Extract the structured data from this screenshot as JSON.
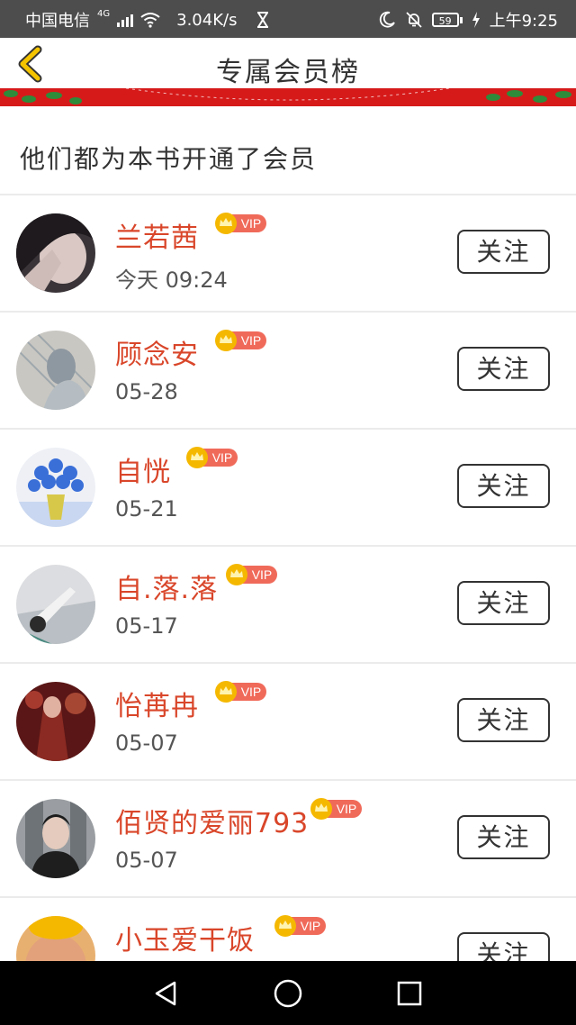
{
  "status_bar": {
    "carrier": "中国电信",
    "network_type": "4G",
    "speed": "3.04K/s",
    "battery": "59",
    "time": "上午9:25"
  },
  "header": {
    "title": "专属会员榜",
    "back_icon": "chevron-left-icon"
  },
  "subheading": "他们都为本书开通了会员",
  "members": [
    {
      "name": "兰若茜",
      "date": "今天 09:24",
      "badge": "VIP",
      "follow": "关注"
    },
    {
      "name": "顾念安",
      "date": "05-28",
      "badge": "VIP",
      "follow": "关注"
    },
    {
      "name": "自恍",
      "date": "05-21",
      "badge": "VIP",
      "follow": "关注"
    },
    {
      "name": "自.落.落",
      "date": "05-17",
      "badge": "VIP",
      "follow": "关注"
    },
    {
      "name": "怡苒冉",
      "date": "05-07",
      "badge": "VIP",
      "follow": "关注"
    },
    {
      "name": "佰贤的爱丽793",
      "date": "05-07",
      "badge": "VIP",
      "follow": "关注"
    },
    {
      "name": "小玉爱干饭",
      "date": "",
      "badge": "VIP",
      "follow": "关注"
    }
  ],
  "nav": {
    "back": "triangle-back-icon",
    "home": "circle-home-icon",
    "recents": "square-recents-icon"
  },
  "colors": {
    "accent_name": "#d9462a",
    "banner_red": "#d61a1a",
    "vip_badge": "#f06a5a",
    "crown": "#f5b800"
  }
}
